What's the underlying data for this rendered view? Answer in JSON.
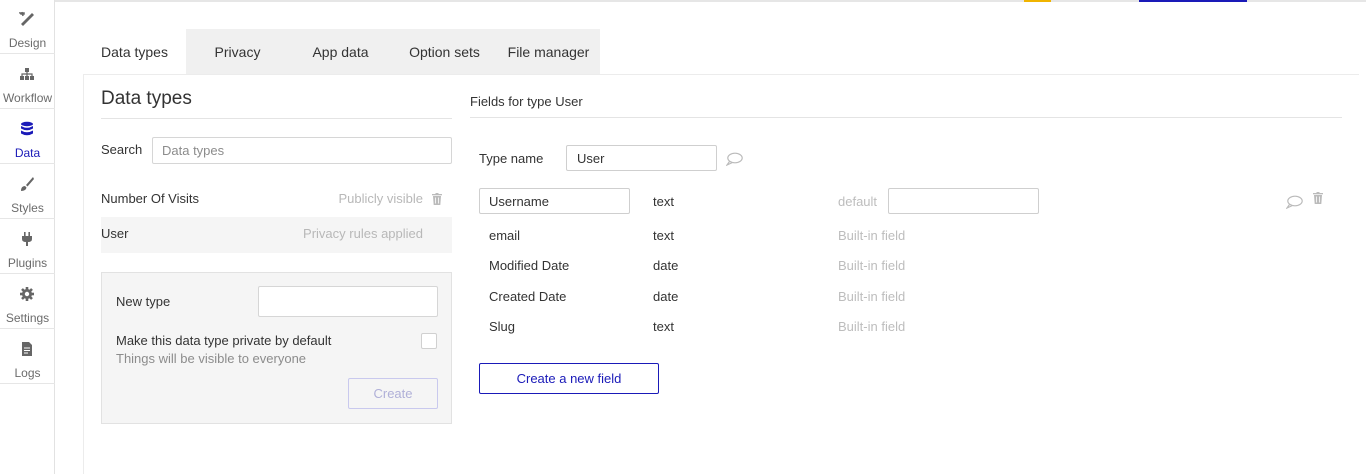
{
  "sidebar": {
    "items": [
      {
        "label": "Design",
        "icon": "design-icon"
      },
      {
        "label": "Workflow",
        "icon": "workflow-icon"
      },
      {
        "label": "Data",
        "icon": "database-icon",
        "active": true
      },
      {
        "label": "Styles",
        "icon": "brush-icon"
      },
      {
        "label": "Plugins",
        "icon": "plug-icon"
      },
      {
        "label": "Settings",
        "icon": "gear-icon"
      },
      {
        "label": "Logs",
        "icon": "document-icon"
      }
    ]
  },
  "tabs": [
    {
      "label": "Data types",
      "active": true
    },
    {
      "label": "Privacy"
    },
    {
      "label": "App data"
    },
    {
      "label": "Option sets"
    },
    {
      "label": "File manager"
    }
  ],
  "left": {
    "heading": "Data types",
    "search_label": "Search",
    "search_placeholder": "Data types",
    "types": [
      {
        "name": "Number Of Visits",
        "status": "Publicly visible"
      },
      {
        "name": "User",
        "status": "Privacy rules applied"
      }
    ],
    "new_type_label": "New type",
    "new_type_value": "",
    "private_label": "Make this data type private by default",
    "private_sub": "Things will be visible to everyone",
    "create_label": "Create"
  },
  "right": {
    "heading": "Fields for type User",
    "type_name_label": "Type name",
    "type_name_value": "User",
    "fields": [
      {
        "name": "Username",
        "type": "text",
        "meta": "default"
      },
      {
        "name": "email",
        "type": "text",
        "meta": "Built-in field"
      },
      {
        "name": "Modified Date",
        "type": "date",
        "meta": "Built-in field"
      },
      {
        "name": "Created Date",
        "type": "date",
        "meta": "Built-in field"
      },
      {
        "name": "Slug",
        "type": "text",
        "meta": "Built-in field"
      }
    ],
    "new_field_label": "Create a new field"
  },
  "colors": {
    "accent": "#1a1ab8",
    "muted_text": "#bdbdbd",
    "tab_bar_bg": "#f0f0f0"
  }
}
